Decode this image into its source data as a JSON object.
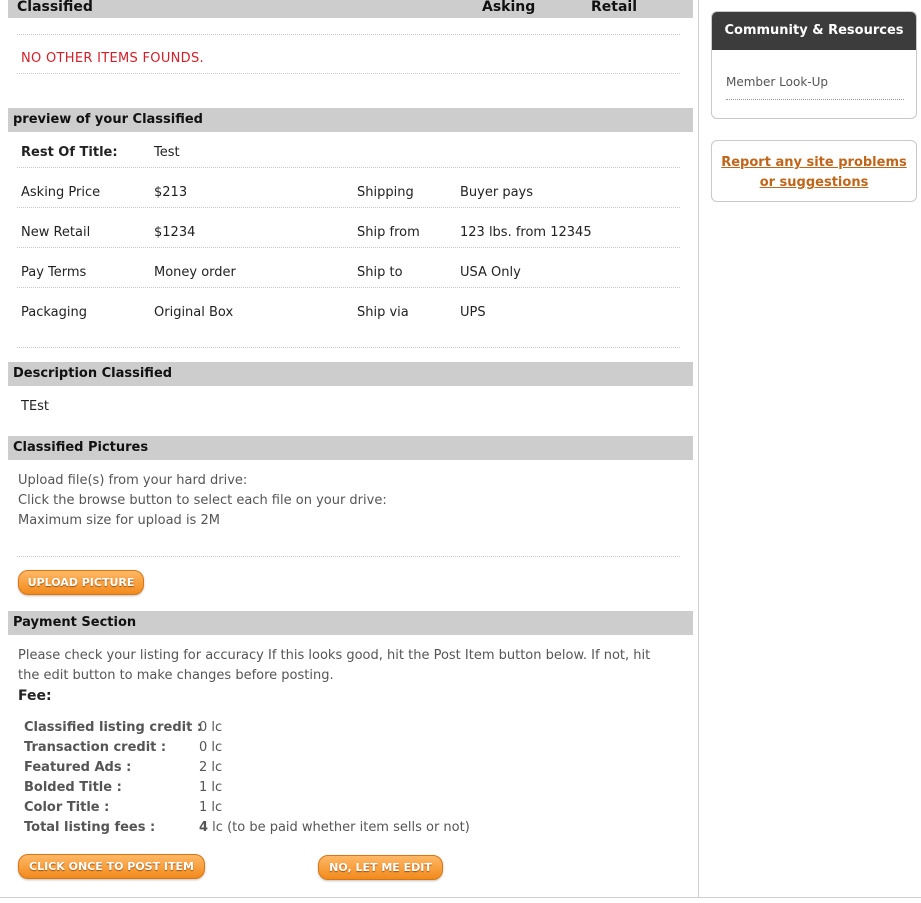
{
  "header": {
    "col_classified": "Classified",
    "col_asking": "Asking",
    "col_retail": "Retail"
  },
  "other_items": {
    "empty_message": "NO OTHER ITEMS FOUNDS."
  },
  "preview": {
    "title": "preview of your Classified",
    "rest_of_title_label": "Rest Of Title:",
    "rest_of_title_value": "Test",
    "asking_price_label": "Asking Price",
    "asking_price_value": "$213",
    "shipping_label": "Shipping",
    "shipping_value": "Buyer pays",
    "new_retail_label": "New Retail",
    "new_retail_value": "$1234",
    "ship_from_label": "Ship from",
    "ship_from_value": "123 lbs. from 12345",
    "pay_terms_label": "Pay Terms",
    "pay_terms_value": "Money order",
    "ship_to_label": "Ship to",
    "ship_to_value": "USA Only",
    "packaging_label": "Packaging",
    "packaging_value": "Original Box",
    "ship_via_label": "Ship via",
    "ship_via_value": "UPS"
  },
  "description": {
    "title": "Description Classified",
    "text": "TEst"
  },
  "pictures": {
    "title": "Classified Pictures",
    "line1": "Upload file(s) from your hard drive:",
    "line2": "Click the browse button to select each file on your drive:",
    "line3": "Maximum size for upload is 2M",
    "upload_button": "UPLOAD PICTURE"
  },
  "payment": {
    "title": "Payment Section",
    "instructions_line1": "Please check your listing for accuracy If this looks good, hit the Post Item button below. If not, hit",
    "instructions_line2": "the edit button to make changes before posting.",
    "fee_heading": "Fee:",
    "fees": [
      {
        "label": "Classified listing credit :",
        "value": "0 lc"
      },
      {
        "label": "Transaction credit :",
        "value": "0 lc"
      },
      {
        "label": "Featured Ads :",
        "value": "2 lc"
      },
      {
        "label": "Bolded Title :",
        "value": "1 lc"
      },
      {
        "label": "Color Title :",
        "value": "1 lc"
      }
    ],
    "total_label": "Total listing fees :",
    "total_amount": "4",
    "total_suffix": " lc (to be paid whether item sells or not)",
    "post_button": "CLICK ONCE TO POST ITEM",
    "edit_button": "NO, LET ME EDIT"
  },
  "sidebar": {
    "community_title": "Community & Resources",
    "member_lookup": "Member Look-Up",
    "report_line1": "Report any site problems",
    "report_line2": "or suggestions"
  },
  "colors": {
    "section_bar": "#cdcdcd",
    "button_orange": "#f28a1c",
    "alert_red": "#d2202a",
    "link_orange": "#c0651a",
    "sidebar_header": "#3c3c3c"
  }
}
